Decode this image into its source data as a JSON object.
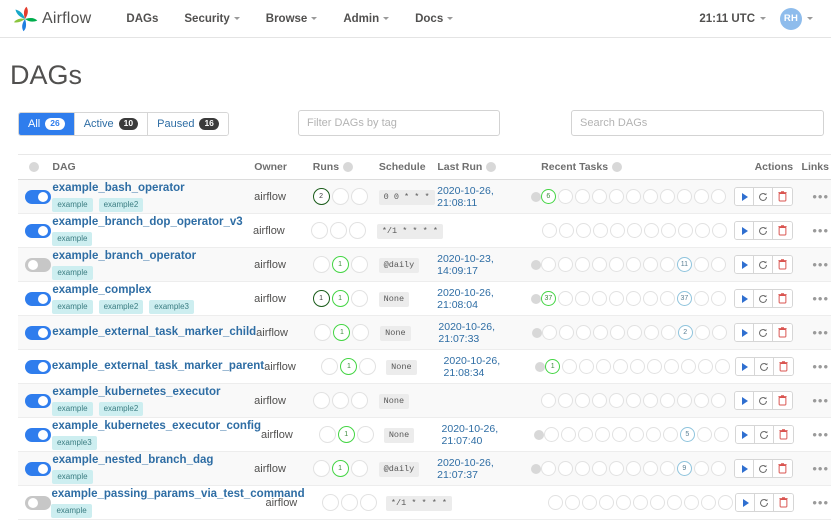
{
  "navbar": {
    "brand": "Airflow",
    "items": [
      {
        "label": "DAGs",
        "caret": false
      },
      {
        "label": "Security",
        "caret": true
      },
      {
        "label": "Browse",
        "caret": true
      },
      {
        "label": "Admin",
        "caret": true
      },
      {
        "label": "Docs",
        "caret": true
      }
    ],
    "time": "21:11 UTC",
    "avatar_initials": "RH"
  },
  "page": {
    "title": "DAGs"
  },
  "filters": {
    "buttons": [
      {
        "label": "All",
        "count": "26",
        "active": true
      },
      {
        "label": "Active",
        "count": "10",
        "active": false
      },
      {
        "label": "Paused",
        "count": "16",
        "active": false
      }
    ],
    "tag_placeholder": "Filter DAGs by tag",
    "search_placeholder": "Search DAGs"
  },
  "table": {
    "headers": {
      "dag": "DAG",
      "owner": "Owner",
      "runs": "Runs",
      "schedule": "Schedule",
      "last_run": "Last Run",
      "recent_tasks": "Recent Tasks",
      "actions": "Actions",
      "links": "Links"
    },
    "rows": [
      {
        "enabled": true,
        "name": "example_bash_operator",
        "tags": [
          "example",
          "example2"
        ],
        "owner": "airflow",
        "runs": [
          {
            "value": "2",
            "state": "dark"
          },
          {
            "value": "",
            "state": "empty"
          },
          {
            "value": "",
            "state": "empty"
          }
        ],
        "schedule": "0 0 * * *",
        "last_run": "2020-10-26, 21:08:11",
        "tasks": [
          {
            "value": "6",
            "state": "success"
          },
          {
            "value": "",
            "state": "empty"
          },
          {
            "value": "",
            "state": "empty"
          },
          {
            "value": "",
            "state": "empty"
          },
          {
            "value": "",
            "state": "empty"
          },
          {
            "value": "",
            "state": "empty"
          },
          {
            "value": "",
            "state": "empty"
          },
          {
            "value": "",
            "state": "empty"
          },
          {
            "value": "",
            "state": "empty"
          },
          {
            "value": "",
            "state": "empty"
          },
          {
            "value": "",
            "state": "empty"
          }
        ]
      },
      {
        "enabled": true,
        "name": "example_branch_dop_operator_v3",
        "tags": [
          "example"
        ],
        "owner": "airflow",
        "runs": [
          {
            "value": "",
            "state": "empty"
          },
          {
            "value": "",
            "state": "empty"
          },
          {
            "value": "",
            "state": "empty"
          }
        ],
        "schedule": "*/1 * * * *",
        "last_run": "",
        "tasks": [
          {
            "value": "",
            "state": "empty"
          },
          {
            "value": "",
            "state": "empty"
          },
          {
            "value": "",
            "state": "empty"
          },
          {
            "value": "",
            "state": "empty"
          },
          {
            "value": "",
            "state": "empty"
          },
          {
            "value": "",
            "state": "empty"
          },
          {
            "value": "",
            "state": "empty"
          },
          {
            "value": "",
            "state": "empty"
          },
          {
            "value": "",
            "state": "empty"
          },
          {
            "value": "",
            "state": "empty"
          },
          {
            "value": "",
            "state": "empty"
          }
        ]
      },
      {
        "enabled": false,
        "name": "example_branch_operator",
        "tags": [
          "example"
        ],
        "owner": "airflow",
        "runs": [
          {
            "value": "",
            "state": "empty"
          },
          {
            "value": "1",
            "state": "success"
          },
          {
            "value": "",
            "state": "empty"
          }
        ],
        "schedule": "@daily",
        "last_run": "2020-10-23, 14:09:17",
        "tasks": [
          {
            "value": "",
            "state": "empty"
          },
          {
            "value": "",
            "state": "empty"
          },
          {
            "value": "",
            "state": "empty"
          },
          {
            "value": "",
            "state": "empty"
          },
          {
            "value": "",
            "state": "empty"
          },
          {
            "value": "",
            "state": "empty"
          },
          {
            "value": "",
            "state": "empty"
          },
          {
            "value": "",
            "state": "empty"
          },
          {
            "value": "11",
            "state": "queued"
          },
          {
            "value": "",
            "state": "empty"
          },
          {
            "value": "",
            "state": "empty"
          }
        ]
      },
      {
        "enabled": true,
        "name": "example_complex",
        "tags": [
          "example",
          "example2",
          "example3"
        ],
        "owner": "airflow",
        "runs": [
          {
            "value": "1",
            "state": "dark"
          },
          {
            "value": "1",
            "state": "success"
          },
          {
            "value": "",
            "state": "empty"
          }
        ],
        "schedule": "None",
        "last_run": "2020-10-26, 21:08:04",
        "tasks": [
          {
            "value": "37",
            "state": "success"
          },
          {
            "value": "",
            "state": "empty"
          },
          {
            "value": "",
            "state": "empty"
          },
          {
            "value": "",
            "state": "empty"
          },
          {
            "value": "",
            "state": "empty"
          },
          {
            "value": "",
            "state": "empty"
          },
          {
            "value": "",
            "state": "empty"
          },
          {
            "value": "",
            "state": "empty"
          },
          {
            "value": "37",
            "state": "queued"
          },
          {
            "value": "",
            "state": "empty"
          },
          {
            "value": "",
            "state": "empty"
          }
        ]
      },
      {
        "enabled": true,
        "name": "example_external_task_marker_child",
        "tags": [],
        "owner": "airflow",
        "runs": [
          {
            "value": "",
            "state": "empty"
          },
          {
            "value": "1",
            "state": "success"
          },
          {
            "value": "",
            "state": "empty"
          }
        ],
        "schedule": "None",
        "last_run": "2020-10-26, 21:07:33",
        "tasks": [
          {
            "value": "",
            "state": "empty"
          },
          {
            "value": "",
            "state": "empty"
          },
          {
            "value": "",
            "state": "empty"
          },
          {
            "value": "",
            "state": "empty"
          },
          {
            "value": "",
            "state": "empty"
          },
          {
            "value": "",
            "state": "empty"
          },
          {
            "value": "",
            "state": "empty"
          },
          {
            "value": "",
            "state": "empty"
          },
          {
            "value": "2",
            "state": "queued"
          },
          {
            "value": "",
            "state": "empty"
          },
          {
            "value": "",
            "state": "empty"
          }
        ]
      },
      {
        "enabled": true,
        "name": "example_external_task_marker_parent",
        "tags": [],
        "owner": "airflow",
        "runs": [
          {
            "value": "",
            "state": "empty"
          },
          {
            "value": "1",
            "state": "success"
          },
          {
            "value": "",
            "state": "empty"
          }
        ],
        "schedule": "None",
        "last_run": "2020-10-26, 21:08:34",
        "tasks": [
          {
            "value": "1",
            "state": "success"
          },
          {
            "value": "",
            "state": "empty"
          },
          {
            "value": "",
            "state": "empty"
          },
          {
            "value": "",
            "state": "empty"
          },
          {
            "value": "",
            "state": "empty"
          },
          {
            "value": "",
            "state": "empty"
          },
          {
            "value": "",
            "state": "empty"
          },
          {
            "value": "",
            "state": "empty"
          },
          {
            "value": "",
            "state": "empty"
          },
          {
            "value": "",
            "state": "empty"
          },
          {
            "value": "",
            "state": "empty"
          }
        ]
      },
      {
        "enabled": true,
        "name": "example_kubernetes_executor",
        "tags": [
          "example",
          "example2"
        ],
        "owner": "airflow",
        "runs": [
          {
            "value": "",
            "state": "empty"
          },
          {
            "value": "",
            "state": "empty"
          },
          {
            "value": "",
            "state": "empty"
          }
        ],
        "schedule": "None",
        "last_run": "",
        "tasks": [
          {
            "value": "",
            "state": "empty"
          },
          {
            "value": "",
            "state": "empty"
          },
          {
            "value": "",
            "state": "empty"
          },
          {
            "value": "",
            "state": "empty"
          },
          {
            "value": "",
            "state": "empty"
          },
          {
            "value": "",
            "state": "empty"
          },
          {
            "value": "",
            "state": "empty"
          },
          {
            "value": "",
            "state": "empty"
          },
          {
            "value": "",
            "state": "empty"
          },
          {
            "value": "",
            "state": "empty"
          },
          {
            "value": "",
            "state": "empty"
          }
        ]
      },
      {
        "enabled": true,
        "name": "example_kubernetes_executor_config",
        "tags": [
          "example3"
        ],
        "owner": "airflow",
        "runs": [
          {
            "value": "",
            "state": "empty"
          },
          {
            "value": "1",
            "state": "success"
          },
          {
            "value": "",
            "state": "empty"
          }
        ],
        "schedule": "None",
        "last_run": "2020-10-26, 21:07:40",
        "tasks": [
          {
            "value": "",
            "state": "empty"
          },
          {
            "value": "",
            "state": "empty"
          },
          {
            "value": "",
            "state": "empty"
          },
          {
            "value": "",
            "state": "empty"
          },
          {
            "value": "",
            "state": "empty"
          },
          {
            "value": "",
            "state": "empty"
          },
          {
            "value": "",
            "state": "empty"
          },
          {
            "value": "",
            "state": "empty"
          },
          {
            "value": "5",
            "state": "queued"
          },
          {
            "value": "",
            "state": "empty"
          },
          {
            "value": "",
            "state": "empty"
          }
        ]
      },
      {
        "enabled": true,
        "name": "example_nested_branch_dag",
        "tags": [
          "example"
        ],
        "owner": "airflow",
        "runs": [
          {
            "value": "",
            "state": "empty"
          },
          {
            "value": "1",
            "state": "success"
          },
          {
            "value": "",
            "state": "empty"
          }
        ],
        "schedule": "@daily",
        "last_run": "2020-10-26, 21:07:37",
        "tasks": [
          {
            "value": "",
            "state": "empty"
          },
          {
            "value": "",
            "state": "empty"
          },
          {
            "value": "",
            "state": "empty"
          },
          {
            "value": "",
            "state": "empty"
          },
          {
            "value": "",
            "state": "empty"
          },
          {
            "value": "",
            "state": "empty"
          },
          {
            "value": "",
            "state": "empty"
          },
          {
            "value": "",
            "state": "empty"
          },
          {
            "value": "9",
            "state": "queued"
          },
          {
            "value": "",
            "state": "empty"
          },
          {
            "value": "",
            "state": "empty"
          }
        ]
      },
      {
        "enabled": false,
        "name": "example_passing_params_via_test_command",
        "tags": [
          "example"
        ],
        "owner": "airflow",
        "runs": [
          {
            "value": "",
            "state": "empty"
          },
          {
            "value": "",
            "state": "empty"
          },
          {
            "value": "",
            "state": "empty"
          }
        ],
        "schedule": "*/1 * * * *",
        "last_run": "",
        "tasks": [
          {
            "value": "",
            "state": "empty"
          },
          {
            "value": "",
            "state": "empty"
          },
          {
            "value": "",
            "state": "empty"
          },
          {
            "value": "",
            "state": "empty"
          },
          {
            "value": "",
            "state": "empty"
          },
          {
            "value": "",
            "state": "empty"
          },
          {
            "value": "",
            "state": "empty"
          },
          {
            "value": "",
            "state": "empty"
          },
          {
            "value": "",
            "state": "empty"
          },
          {
            "value": "",
            "state": "empty"
          },
          {
            "value": "",
            "state": "empty"
          }
        ]
      }
    ],
    "links_label": "•••"
  },
  "colors": {
    "accent": "#2f7ded",
    "link": "#2e6da4",
    "success": "#44d544",
    "queued": "#8fc4dd",
    "danger": "#d9534f",
    "tag_bg": "#cdeef0"
  }
}
